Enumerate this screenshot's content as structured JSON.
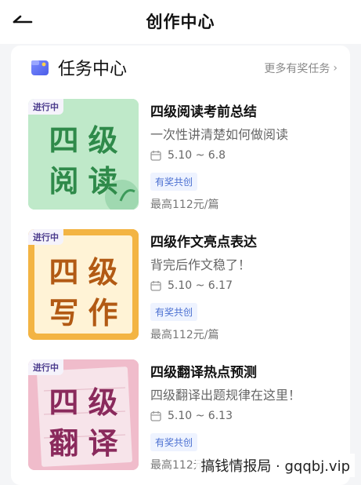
{
  "header": {
    "title": "创作中心",
    "back_icon": "back-arrow-icon"
  },
  "section": {
    "title": "任务中心",
    "more_label": "更多有奖任务",
    "more_icon": "chevron-right-icon",
    "folder_icon": "folder-icon"
  },
  "tasks": [
    {
      "status": "进行中",
      "thumb_line1": "四级",
      "thumb_line2": "阅读",
      "title": "四级阅读考前总结",
      "subtitle": "一次性讲清楚如何做阅读",
      "date": "5.10 ~ 6.8",
      "badge": "有奖共创",
      "price": "最高112元/篇",
      "colors": {
        "bg": "#b8e8c4",
        "text": "#2f8a4a"
      }
    },
    {
      "status": "进行中",
      "thumb_line1": "四级",
      "thumb_line2": "写作",
      "title": "四级作文亮点表达",
      "subtitle": "背完后作文稳了！",
      "date": "5.10 ~ 6.17",
      "badge": "有奖共创",
      "price": "最高112元/篇",
      "colors": {
        "bg": "#fff2cf",
        "text": "#b25a14",
        "border": "#f3b443"
      }
    },
    {
      "status": "进行中",
      "thumb_line1": "四级",
      "thumb_line2": "翻译",
      "title": "四级翻译热点预测",
      "subtitle": "四级翻译出题规律在这里！",
      "date": "5.10 ~ 6.13",
      "badge": "有奖共创",
      "price": "最高112元/篇",
      "colors": {
        "bg": "#f3c3cf",
        "text": "#8a2a5c"
      }
    }
  ],
  "watermark": "搞钱情报局 · gqqbj.vip"
}
